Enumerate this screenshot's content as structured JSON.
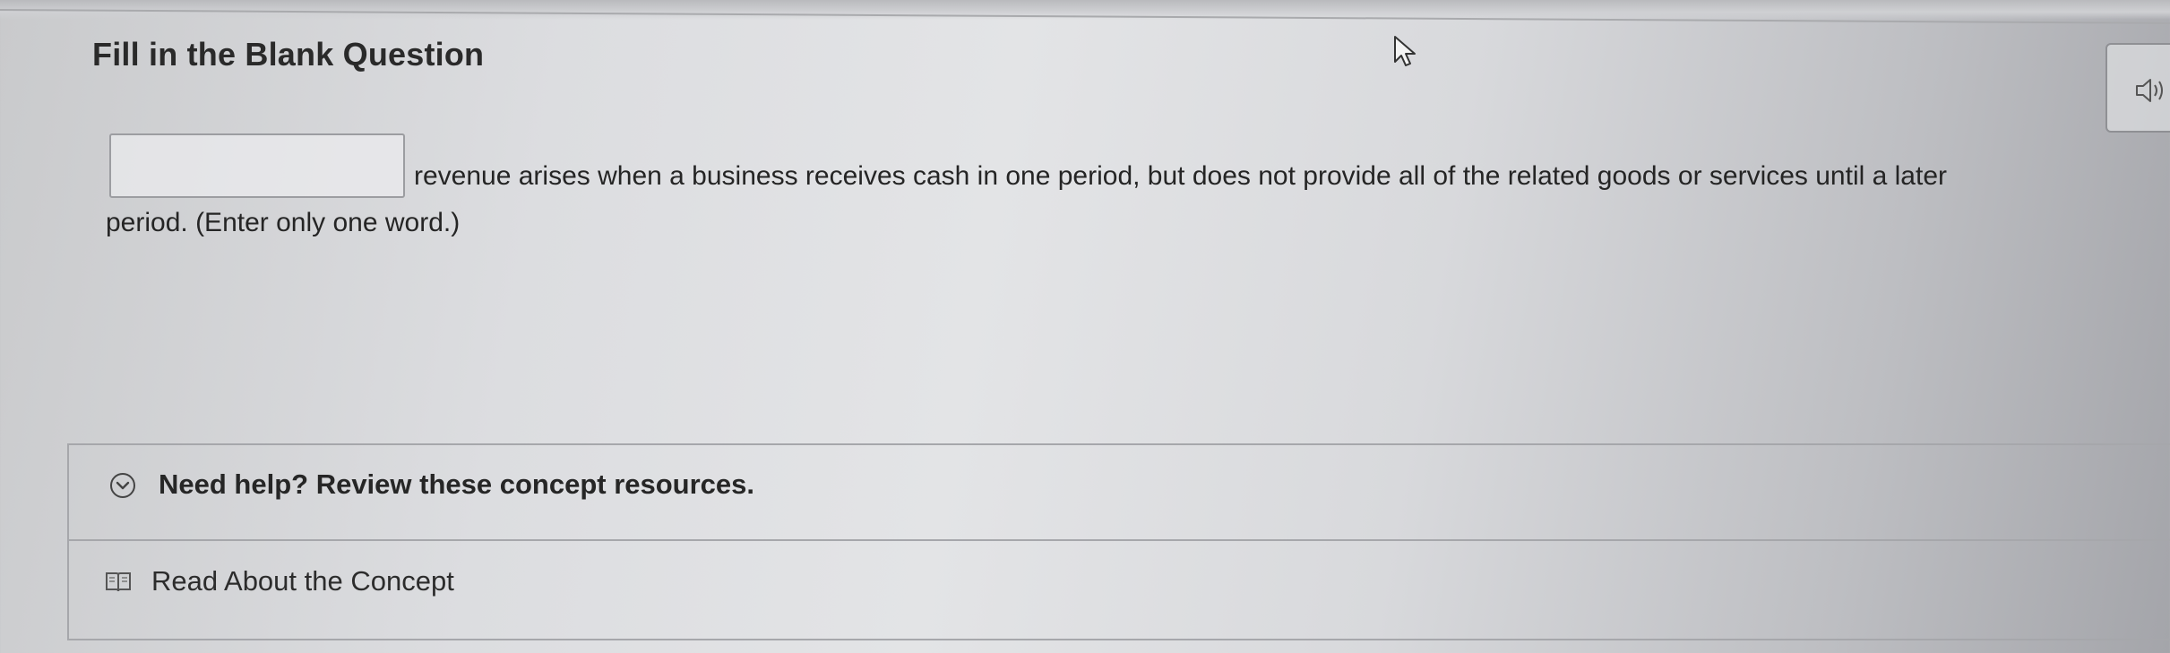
{
  "question": {
    "title": "Fill in the Blank Question",
    "blank_value": "",
    "prompt_line1": "revenue arises when a business receives cash in one period, but does not provide all of the related goods or services until a later",
    "prompt_line2": "period. (Enter only one word.)"
  },
  "audio": {
    "icon": "speaker-icon"
  },
  "help": {
    "header_label": "Need help? Review these concept resources.",
    "header_icon": "chevron-down-circle-icon",
    "resources": [
      {
        "label": "Read About the Concept",
        "icon": "book-icon"
      }
    ]
  },
  "colors": {
    "text": "#252525",
    "border": "#a6a7ab"
  }
}
